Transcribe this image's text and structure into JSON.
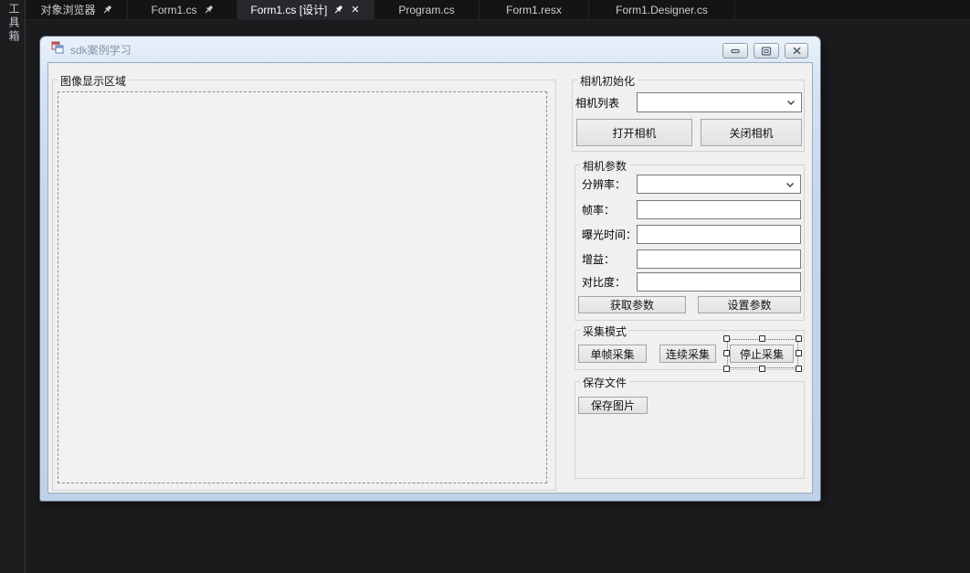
{
  "tab_bar": {
    "tabs": [
      {
        "label": "对象浏览器",
        "pinned": true,
        "active": false
      },
      {
        "label": "Form1.cs",
        "pinned": true,
        "active": false
      },
      {
        "label": "Form1.cs [设计]",
        "pinned": true,
        "active": true,
        "close_glyph": "✕"
      },
      {
        "label": "Program.cs",
        "pinned": false,
        "active": false
      },
      {
        "label": "Form1.resx",
        "pinned": false,
        "active": false
      },
      {
        "label": "Form1.Designer.cs",
        "pinned": false,
        "active": false
      }
    ]
  },
  "toolbox": {
    "label": "工具箱"
  },
  "form": {
    "title": "sdk案例学习",
    "groups": {
      "image": {
        "caption": "图像显示区域"
      },
      "init": {
        "caption": "相机初始化",
        "camera_list_label": "相机列表",
        "camera_list_value": "",
        "open_button": "打开相机",
        "close_button": "关闭相机"
      },
      "params": {
        "caption": "相机参数",
        "rows": [
          {
            "label": "分辨率：",
            "value": "",
            "control": "combobox"
          },
          {
            "label": "帧率：",
            "value": "",
            "control": "textbox"
          },
          {
            "label": "曝光时间：",
            "value": "",
            "control": "textbox"
          },
          {
            "label": "增益：",
            "value": "",
            "control": "textbox"
          },
          {
            "label": "对比度：",
            "value": "",
            "control": "textbox"
          }
        ],
        "get_button": "获取参数",
        "set_button": "设置参数"
      },
      "capture": {
        "caption": "采集模式",
        "single_button": "单帧采集",
        "continuous_button": "连续采集",
        "stop_button": "停止采集",
        "selected_control": "停止采集"
      },
      "save": {
        "caption": "保存文件",
        "save_button": "保存图片"
      }
    }
  },
  "colors": {
    "editor_bg": "#1b1b1d",
    "tabbar_bg": "#141414",
    "active_tab_bg": "#26282c",
    "aero_frame": "#c5d7ec",
    "client_bg": "#f0f0f0",
    "button_face": "#e6e6e6",
    "selection_handle": "#ffffff"
  }
}
